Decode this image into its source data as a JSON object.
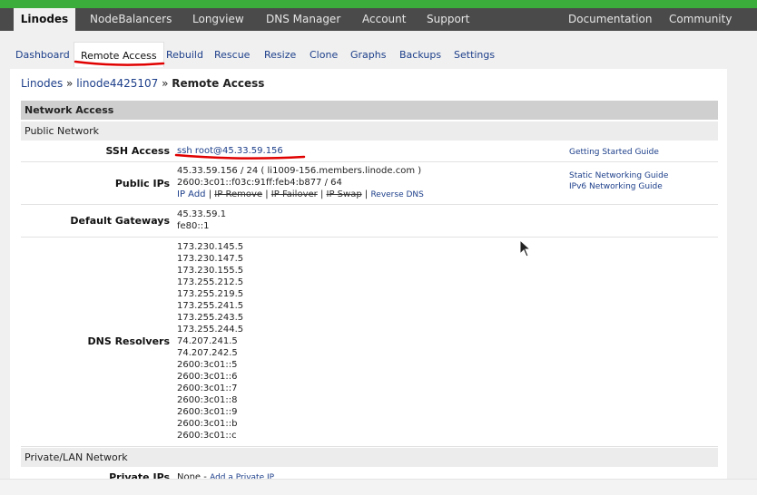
{
  "topnav": {
    "items": [
      "Linodes",
      "NodeBalancers",
      "Longview",
      "DNS Manager",
      "Account",
      "Support"
    ],
    "right_items": [
      "Documentation",
      "Community"
    ]
  },
  "subnav": {
    "tabs": [
      "Dashboard",
      "Remote Access",
      "Rebuild",
      "Rescue",
      "Resize",
      "Clone",
      "Graphs",
      "Backups",
      "Settings"
    ],
    "active": "Remote Access"
  },
  "breadcrumb": {
    "items": [
      "Linodes",
      "linode4425107"
    ],
    "separator": "»",
    "current": "Remote Access"
  },
  "network_access": {
    "title": "Network Access",
    "public_network": {
      "title": "Public Network",
      "ssh_access": {
        "label": "SSH Access",
        "value": "ssh root@45.33.59.156",
        "guide": "Getting Started Guide"
      },
      "public_ips": {
        "label": "Public IPs",
        "ipv4": "45.33.59.156 / 24 ( li1009-156.members.linode.com )",
        "ipv6": "2600:3c01::f03c:91ff:feb4:b877 / 64",
        "actions": {
          "ip_add": "IP Add",
          "ip_remove": "IP Remove",
          "ip_failover": "IP Failover",
          "ip_swap": "IP Swap",
          "reverse_dns": "Reverse DNS",
          "separator": "|"
        },
        "guides": [
          "Static Networking Guide",
          "IPv6 Networking Guide"
        ]
      },
      "default_gateways": {
        "label": "Default Gateways",
        "values": [
          "45.33.59.1",
          "fe80::1"
        ]
      },
      "dns_resolvers": {
        "label": "DNS Resolvers",
        "values": [
          "173.230.145.5",
          "173.230.147.5",
          "173.230.155.5",
          "173.255.212.5",
          "173.255.219.5",
          "173.255.241.5",
          "173.255.243.5",
          "173.255.244.5",
          "74.207.241.5",
          "74.207.242.5",
          "2600:3c01::5",
          "2600:3c01::6",
          "2600:3c01::7",
          "2600:3c01::8",
          "2600:3c01::9",
          "2600:3c01::b",
          "2600:3c01::c"
        ]
      }
    },
    "private_network": {
      "title": "Private/LAN Network",
      "private_ips": {
        "label": "Private IPs",
        "value": "None",
        "separator": "-",
        "add_link": "Add a Private IP"
      }
    }
  },
  "colors": {
    "green_band": "#3aad3a",
    "topnav_bg": "#4a4a4a",
    "link": "#1d3f8a",
    "annotation_red": "#e00000"
  },
  "icons": {
    "mouse_cursor": "cursor-arrow-icon"
  }
}
